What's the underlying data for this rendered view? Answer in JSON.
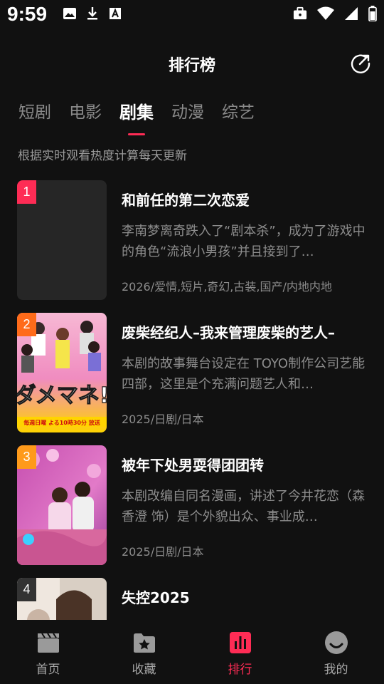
{
  "status_bar": {
    "time": "9:59",
    "left_icons": [
      "image-icon",
      "download-icon",
      "text-icon"
    ],
    "right_icons": [
      "briefcase-icon",
      "wifi-icon",
      "signal-icon",
      "battery-icon"
    ]
  },
  "header": {
    "title": "排行榜",
    "share_icon": "share-icon"
  },
  "tabs": [
    {
      "label": "短剧",
      "active": false
    },
    {
      "label": "电影",
      "active": false
    },
    {
      "label": "剧集",
      "active": true
    },
    {
      "label": "动漫",
      "active": false
    },
    {
      "label": "综艺",
      "active": false
    }
  ],
  "subtitle": "根据实时观看热度计算每天更新",
  "items": [
    {
      "rank": "1",
      "rank_color": "#fe2c55",
      "title": "和前任的第二次恋爱",
      "desc": "李南梦离奇跌入了“剧本杀”，成为了游戏中的角色“流浪小男孩”并且接到了…",
      "meta": "2026/爱情,短片,奇幻,古装,国产/内地内地"
    },
    {
      "rank": "2",
      "rank_color": "#ff6b1a",
      "title": "废柴经纪人–我来管理废柴的艺人–",
      "desc": "本剧的故事舞台设定在 TOYO制作公司艺能四部，这里是个充满问题艺人和…",
      "meta": "2025/日剧/日本",
      "poster_text": "ダメマネ!",
      "poster_caption": "毎週日曜 よる10時30分 放送"
    },
    {
      "rank": "3",
      "rank_color": "#ff9a1a",
      "title": "被年下处男耍得团团转",
      "desc": "本剧改编自同名漫画，讲述了今井花恋（森香澄 饰）是个外貌出众、事业成…",
      "meta": "2025/日剧/日本"
    },
    {
      "rank": "4",
      "rank_color": "#333333",
      "title": "失控2025",
      "desc": "",
      "meta": ""
    }
  ],
  "bottom_nav": [
    {
      "label": "首页",
      "icon": "clapperboard-icon",
      "active": false
    },
    {
      "label": "收藏",
      "icon": "folder-star-icon",
      "active": false
    },
    {
      "label": "排行",
      "icon": "chart-icon",
      "active": true
    },
    {
      "label": "我的",
      "icon": "smile-icon",
      "active": false
    }
  ],
  "colors": {
    "background": "#111111",
    "accent": "#fe2c55",
    "text_secondary": "#8c8c8c"
  }
}
